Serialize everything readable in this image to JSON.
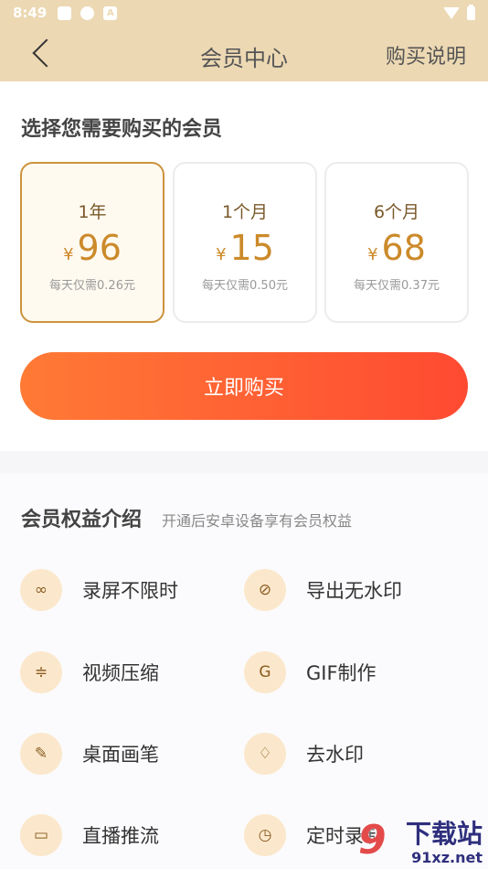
{
  "status_bar": {
    "time": "8:49",
    "icons": [
      "square-icon",
      "ring-icon",
      "a-icon",
      "wifi-icon",
      "battery-icon"
    ]
  },
  "nav": {
    "title": "会员中心",
    "right_label": "购买说明"
  },
  "plans_section": {
    "title": "选择您需要购买的会员",
    "plans": [
      {
        "name": "1年",
        "currency": "¥",
        "price": "96",
        "daily": "每天仅需0.26元",
        "selected": true
      },
      {
        "name": "1个月",
        "currency": "¥",
        "price": "15",
        "daily": "每天仅需0.50元",
        "selected": false
      },
      {
        "name": "6个月",
        "currency": "¥",
        "price": "68",
        "daily": "每天仅需0.37元",
        "selected": false
      }
    ],
    "buy_label": "立即购买"
  },
  "benefits": {
    "title": "会员权益介绍",
    "subtitle": "开通后安卓设备享有会员权益",
    "items": [
      {
        "label": "录屏不限时",
        "icon": "infinity-icon",
        "glyph": "∞"
      },
      {
        "label": "导出无水印",
        "icon": "no-watermark-icon",
        "glyph": "⊘"
      },
      {
        "label": "视频压缩",
        "icon": "compress-icon",
        "glyph": "≑"
      },
      {
        "label": "GIF制作",
        "icon": "gif-icon",
        "glyph": "G"
      },
      {
        "label": "桌面画笔",
        "icon": "brush-icon",
        "glyph": "✎"
      },
      {
        "label": "去水印",
        "icon": "drop-icon",
        "glyph": "♢"
      },
      {
        "label": "直播推流",
        "icon": "tv-icon",
        "glyph": "▭"
      },
      {
        "label": "定时录制",
        "icon": "clock-icon",
        "glyph": "◷"
      }
    ]
  },
  "watermark": {
    "logo": "9",
    "name": "下载站",
    "url": "91xz.net"
  },
  "colors": {
    "header": "#ecd8b3",
    "accent": "#cc933d",
    "price": "#cc8a2a",
    "button_start": "#ff7a35",
    "button_end": "#ff4a32",
    "icon_bg": "#fbe8cc"
  }
}
